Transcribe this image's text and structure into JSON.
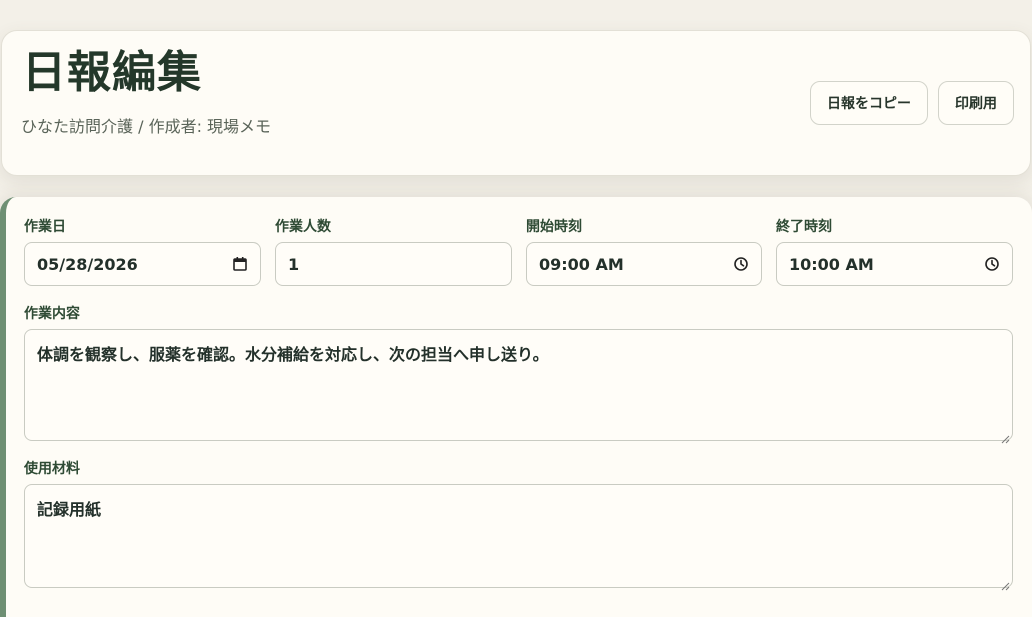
{
  "header": {
    "title": "日報編集",
    "subtitle": "ひなた訪問介護 / 作成者: 現場メモ",
    "copy_button": "日報をコピー",
    "print_button": "印刷用"
  },
  "form": {
    "date": {
      "label": "作業日",
      "value": "05/28/2026"
    },
    "workers": {
      "label": "作業人数",
      "value": "1"
    },
    "start_time": {
      "label": "開始時刻",
      "value": "09:00 AM"
    },
    "end_time": {
      "label": "終了時刻",
      "value": "10:00 AM"
    },
    "work_content": {
      "label": "作業内容",
      "value": "体調を観察し、服薬を確認。水分補給を対応し、次の担当へ申し送り。"
    },
    "materials": {
      "label": "使用材料",
      "value": "記録用紙"
    }
  },
  "icons": {
    "date_picker": "calendar-icon",
    "time_picker": "clock-icon"
  },
  "colors": {
    "accent_bar": "#6e8f73",
    "label_text": "#2e4a34",
    "card_bg": "#fefcf6"
  }
}
